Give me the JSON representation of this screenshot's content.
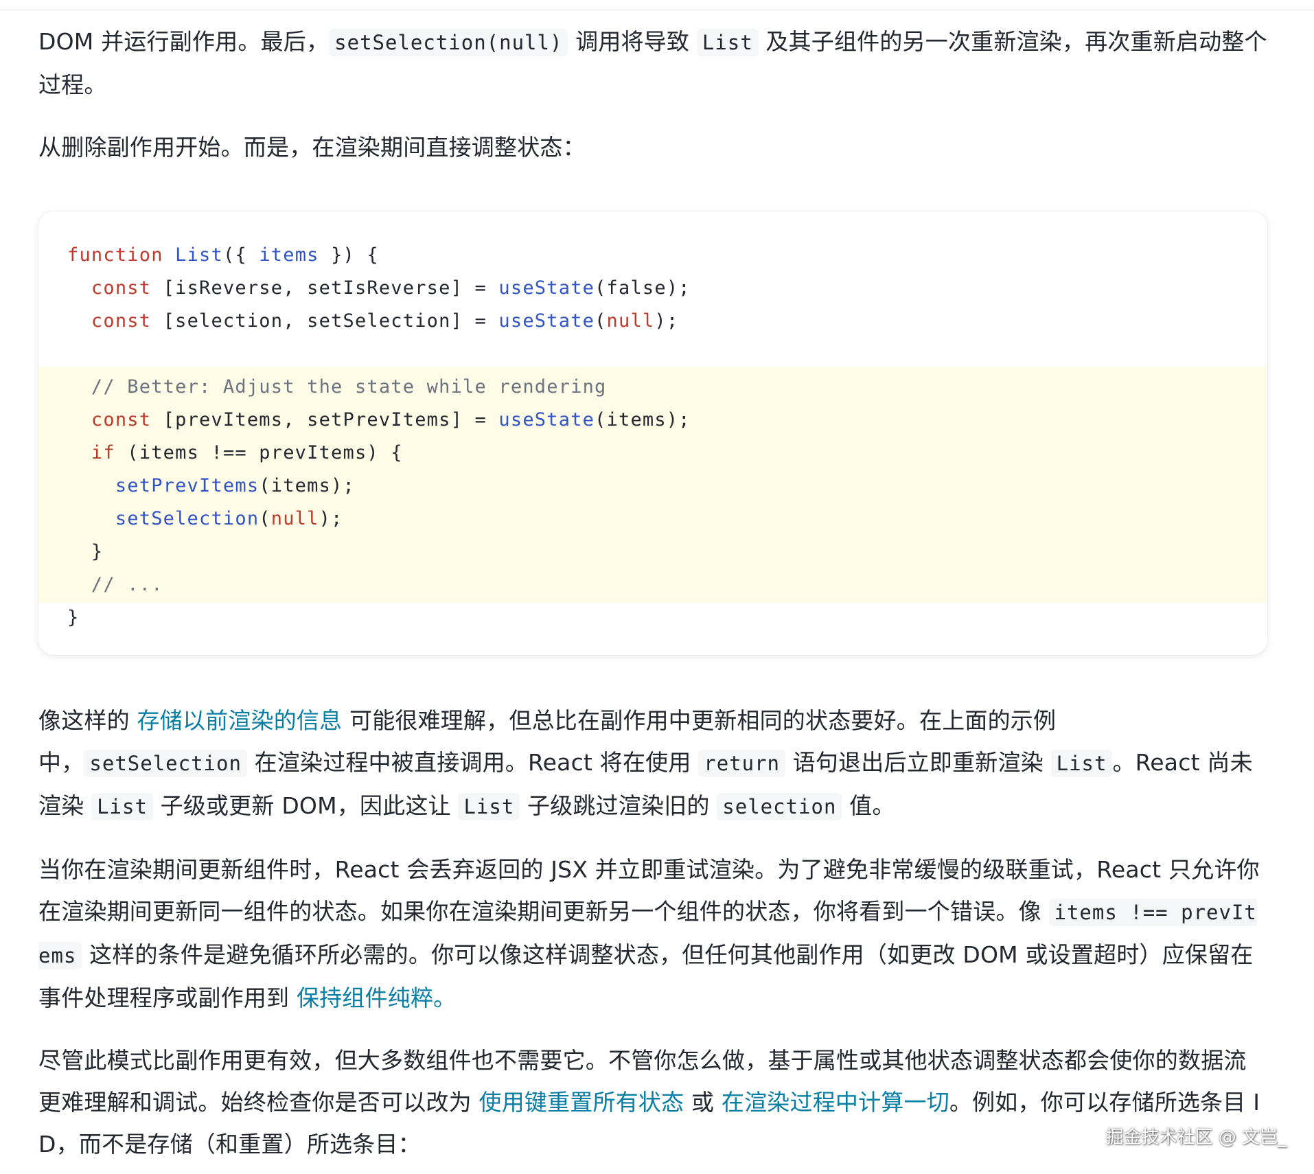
{
  "para1": {
    "t1": "DOM 并运行副作用。最后，",
    "c1": "setSelection(null)",
    "t2": " 调用将导致 ",
    "c2": "List",
    "t3": " 及其子组件的另一次重新渲染，再次重新启动整个过程。"
  },
  "para2": {
    "t1": "从删除副作用开始。而是，在渲染期间直接调整状态："
  },
  "code": {
    "l1": {
      "kw": "function",
      "fn": "List",
      "open": "({ ",
      "param": "items",
      "close": " }) {"
    },
    "l2": {
      "kw": "const",
      "body": " [isReverse, setIsReverse] = ",
      "fn": "useState",
      "p1": "(",
      "val": "false",
      "p2": ");"
    },
    "l3": {
      "kw": "const",
      "body": " [selection, setSelection] = ",
      "fn": "useState",
      "p1": "(",
      "val": "null",
      "p2": ");"
    },
    "l4": {
      "comment": "// Better: Adjust the state while rendering"
    },
    "l5": {
      "kw": "const",
      "body": " [prevItems, setPrevItems] = ",
      "fn": "useState",
      "rest": "(items);"
    },
    "l6": {
      "kw": "if",
      "rest": " (items !== prevItems) {"
    },
    "l7": {
      "fn": "setPrevItems",
      "rest": "(items);"
    },
    "l8": {
      "fn": "setSelection",
      "p1": "(",
      "val": "null",
      "p2": ");"
    },
    "l9": {
      "text": "}"
    },
    "l10": {
      "comment": "// ..."
    },
    "l11": {
      "text": "}"
    }
  },
  "para3": {
    "t1": "像这样的 ",
    "link1": "存储以前渲染的信息",
    "t2": " 可能很难理解，但总比在副作用中更新相同的状态要好。在上面的示例",
    "t3": "中，",
    "c1": "setSelection",
    "t4": " 在渲染过程中被直接调用。React 将在使用 ",
    "c2": "return",
    "t5": " 语句退出后立即重新渲染 ",
    "c3": "List",
    "t6": "。React 尚未渲染 ",
    "c4": "List",
    "t7": " 子级或更新 DOM，因此这让 ",
    "c5": "List",
    "t8": " 子级跳过渲染旧的 ",
    "c6": "selection",
    "t9": " 值。"
  },
  "para4": {
    "t1": "当你在渲染期间更新组件时，React 会丢弃返回的 JSX 并立即重试渲染。为了避免非常缓慢的级联重试，React 只允许你在渲染期间更新同一组件的状态。如果你在渲染期间更新另一个组件的状态，你将看到一个错误。像 ",
    "c1": "items !== prevItems",
    "t2": " 这样的条件是避免循环所必需的。你可以像这样调整状态，但任何其他副作用（如更改 DOM 或设置超时）应保留在事件处理程序或副作用到 ",
    "link1": "保持组件纯粹。"
  },
  "para5": {
    "t1": "尽管此模式比副作用更有效，但大多数组件也不需要它。不管你怎么做，基于属性或其他状态调整状态都会使你的数据流更难理解和调试。始终检查你是否可以改为 ",
    "link1": "使用键重置所有状态",
    "t2": " 或 ",
    "link2": "在渲染过程中计算一切",
    "t3": "。例如，你可以存储所选条目 ID，而不是存储（和重置）所选条目："
  },
  "watermark": "掘金技术社区 @ 文岂_"
}
